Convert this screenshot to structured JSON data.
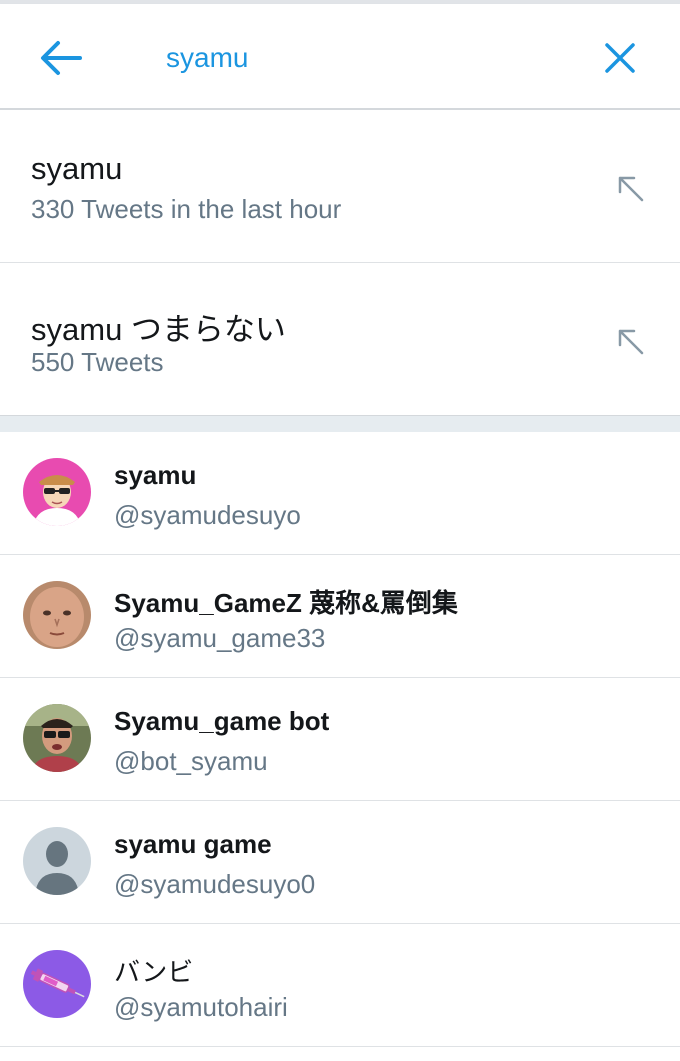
{
  "search": {
    "query": "syamu",
    "back_icon": "arrow-left-icon",
    "clear_icon": "close-icon",
    "accent_color": "#1b95e0"
  },
  "suggestions": [
    {
      "title": "syamu",
      "subtitle": "330 Tweets in the last hour",
      "icon": "arrow-up-left-icon"
    },
    {
      "title": "syamu つまらない",
      "subtitle": "550 Tweets",
      "icon": "arrow-up-left-icon"
    }
  ],
  "users": [
    {
      "name": "syamu",
      "handle": "@syamudesuyo",
      "avatar": "cartoon-sunglasses-avatar"
    },
    {
      "name": "Syamu_GameZ 蔑称&罵倒集",
      "handle": "@syamu_game33",
      "avatar": "face-photo-avatar"
    },
    {
      "name": "Syamu_game bot",
      "handle": "@bot_syamu",
      "avatar": "sunglasses-photo-avatar"
    },
    {
      "name": "syamu game",
      "handle": "@syamudesuyo0",
      "avatar": "default-person-avatar"
    },
    {
      "name": "バンビ",
      "handle": "@syamutohairi",
      "avatar": "syringe-purple-avatar"
    }
  ]
}
